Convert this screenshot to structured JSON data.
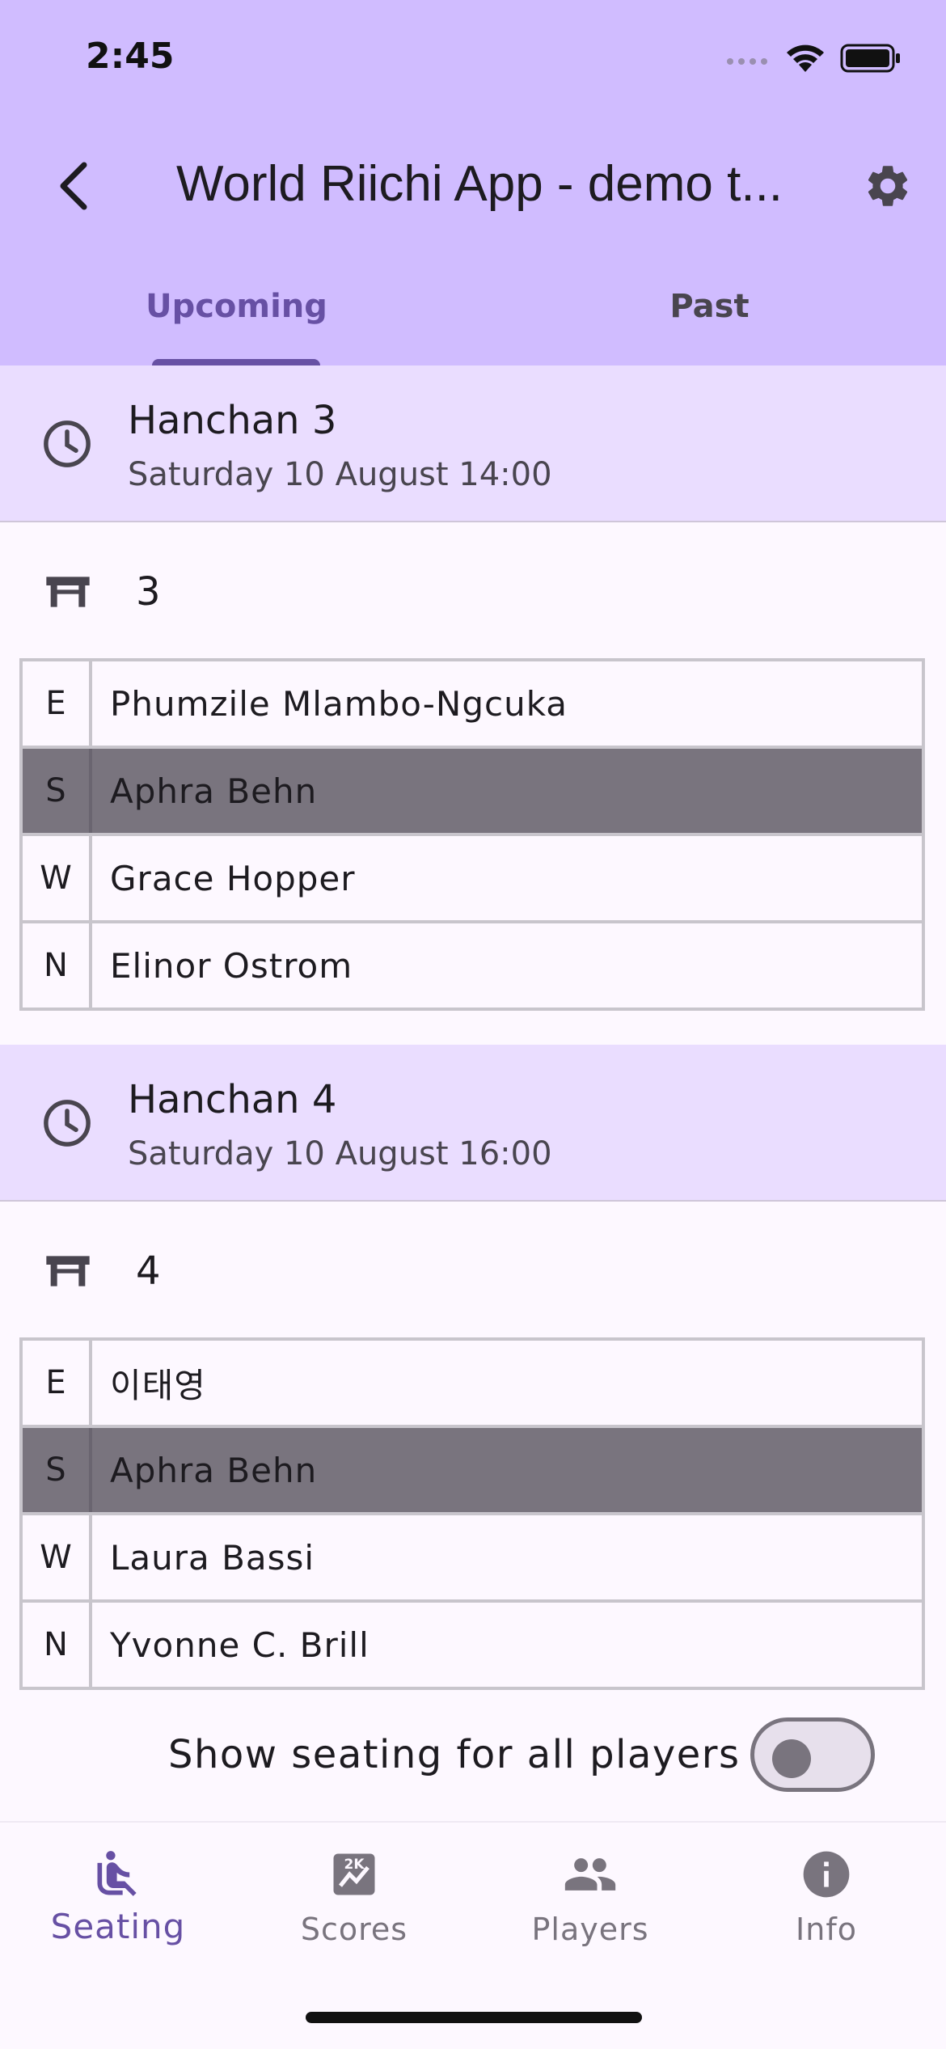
{
  "status_bar": {
    "time": "2:45"
  },
  "app_bar": {
    "title": "World Riichi App - demo t..."
  },
  "tabs": {
    "upcoming": "Upcoming",
    "past": "Past"
  },
  "rounds": [
    {
      "title": "Hanchan 3",
      "time": "Saturday 10 August 14:00",
      "table": "3",
      "seats": [
        {
          "wind": "E",
          "name": "Phumzile Mlambo-Ngcuka"
        },
        {
          "wind": "S",
          "name": "Aphra Behn"
        },
        {
          "wind": "W",
          "name": "Grace Hopper"
        },
        {
          "wind": "N",
          "name": "Elinor Ostrom"
        }
      ]
    },
    {
      "title": "Hanchan 4",
      "time": "Saturday 10 August 16:00",
      "table": "4",
      "seats": [
        {
          "wind": "E",
          "name": "이태영"
        },
        {
          "wind": "S",
          "name": "Aphra Behn"
        },
        {
          "wind": "W",
          "name": "Laura Bassi"
        },
        {
          "wind": "N",
          "name": "Yvonne C. Brill"
        }
      ]
    }
  ],
  "toggle": {
    "label": "Show seating for all players",
    "on": false
  },
  "bottom_nav": {
    "seating": "Seating",
    "scores": "Scores",
    "players": "Players",
    "info": "Info"
  },
  "colors": {
    "header_bg": "#d0bcff",
    "round_header_bg": "#eaddff",
    "accent": "#6750a4",
    "highlight_row": "#79747e"
  }
}
